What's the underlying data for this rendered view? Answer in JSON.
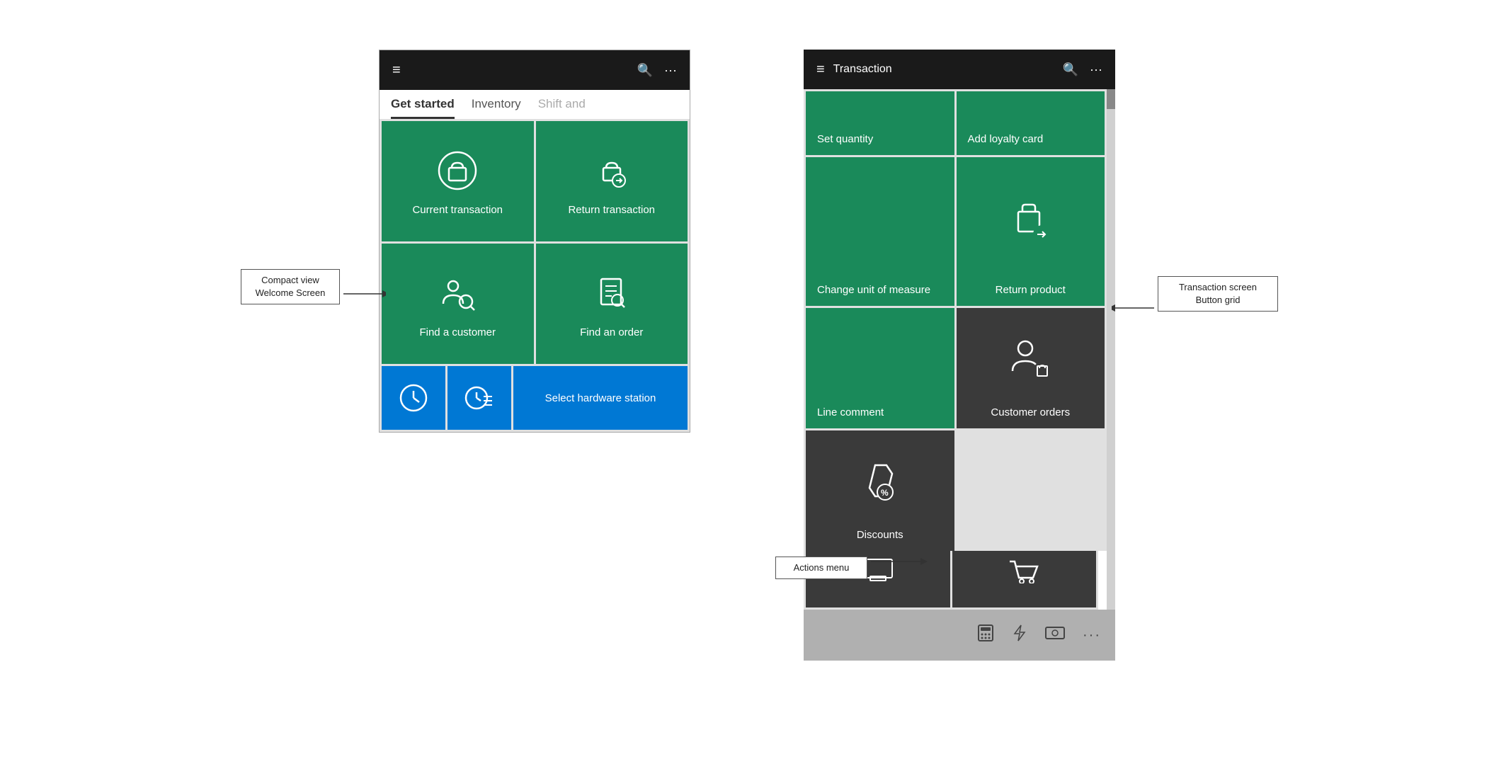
{
  "left_screen": {
    "header": {
      "title": "",
      "hamburger": "≡",
      "search": "🔍",
      "more": "···"
    },
    "tabs": [
      {
        "label": "Get started",
        "active": true
      },
      {
        "label": "Inventory",
        "active": false
      },
      {
        "label": "Shift and",
        "active": false,
        "faded": true
      }
    ],
    "tiles": [
      {
        "id": "current-transaction",
        "label": "Current transaction",
        "color": "green"
      },
      {
        "id": "return-transaction",
        "label": "Return transaction",
        "color": "green"
      },
      {
        "id": "find-customer",
        "label": "Find a customer",
        "color": "green"
      },
      {
        "id": "find-order",
        "label": "Find an order",
        "color": "green"
      }
    ],
    "bottom_tiles": [
      {
        "id": "clock1",
        "label": "",
        "color": "blue"
      },
      {
        "id": "clock2",
        "label": "",
        "color": "blue"
      },
      {
        "id": "hardware-station",
        "label": "Select hardware station",
        "color": "blue"
      }
    ]
  },
  "right_screen": {
    "header": {
      "hamburger": "≡",
      "title": "Transaction",
      "search": "🔍",
      "more": "···"
    },
    "tiles": [
      {
        "id": "set-quantity",
        "label": "Set quantity",
        "color": "green",
        "icon": "none"
      },
      {
        "id": "add-loyalty",
        "label": "Add loyalty card",
        "color": "green",
        "icon": "none"
      },
      {
        "id": "change-uom",
        "label": "Change unit of measure",
        "color": "green",
        "icon": "none"
      },
      {
        "id": "return-product",
        "label": "Return product",
        "color": "green",
        "icon": "box-return"
      },
      {
        "id": "line-comment",
        "label": "Line comment",
        "color": "green",
        "icon": "none"
      },
      {
        "id": "customer-orders",
        "label": "Customer orders",
        "color": "dark",
        "icon": "customer-order"
      },
      {
        "id": "discounts",
        "label": "Discounts",
        "color": "dark",
        "icon": "discount"
      }
    ],
    "bottom_bar": {
      "icons": [
        "calculator",
        "lightning",
        "money",
        "more"
      ]
    }
  },
  "annotations": {
    "compact_view": "Compact view\nWelcome Screen",
    "return_transaction": "Return transaction",
    "find_customer": "Find a customer",
    "change_uom": "Change unit of measure",
    "select_hardware": "Select hardware station",
    "transaction_button_grid": "Transaction screen\nButton grid",
    "actions_menu": "Actions menu",
    "discounts": "Discounts"
  }
}
